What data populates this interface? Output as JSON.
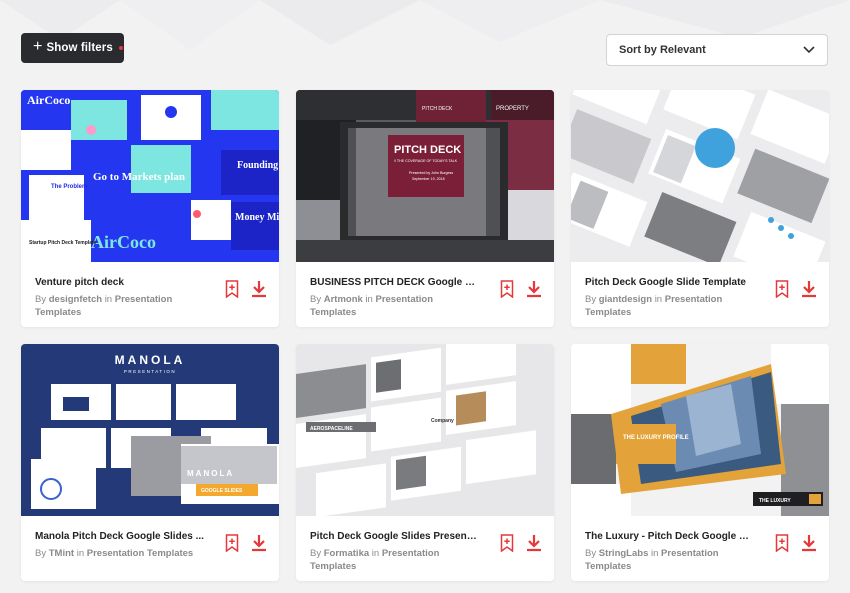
{
  "toolbar": {
    "filters_label": "Show filters",
    "sort_label": "Sort by Relevant"
  },
  "colors": {
    "accent": "#e5383b",
    "dark": "#2a2b2e"
  },
  "icons": {
    "bookmark": "bookmark-add-icon",
    "download": "download-icon",
    "sort": "chevron-down-icon"
  },
  "cards": [
    {
      "title": "Venture pitch deck",
      "by_prefix": "By",
      "author": "designfetch",
      "in_word": "in",
      "category": "Presentation Templates"
    },
    {
      "title": "BUSINESS PITCH DECK Google Sli...",
      "by_prefix": "By",
      "author": "Artmonk",
      "in_word": "in",
      "category": "Presentation Templates"
    },
    {
      "title": "Pitch Deck Google Slide Template",
      "by_prefix": "By",
      "author": "giantdesign",
      "in_word": "in",
      "category": "Presentation Templates"
    },
    {
      "title": "Manola Pitch Deck Google Slides ...",
      "by_prefix": "By",
      "author": "TMint",
      "in_word": "in",
      "category": "Presentation Templates"
    },
    {
      "title": "Pitch Deck Google Slides Presenta...",
      "by_prefix": "By",
      "author": "Formatika",
      "in_word": "in",
      "category": "Presentation Templates"
    },
    {
      "title": "The Luxury - Pitch Deck Google Sl...",
      "by_prefix": "By",
      "author": "StringLabs",
      "in_word": "in",
      "category": "Presentation Templates"
    }
  ],
  "thumb_text": {
    "c1": {
      "brand_top": "AirCoco",
      "slide_a": "Go to Markets plan",
      "slide_b": "Founding Team",
      "slide_c": "Money Miles",
      "brand_bottom": "AirCoco",
      "problem": "The Problem",
      "caption": "Startup Pitch Deck Template"
    },
    "c2": {
      "hero": "PITCH DECK",
      "sub": "// THE COVERAGE OF TODAY'S TALK",
      "presenter": "Presented by John Burgess",
      "date": "September 19, 2018",
      "tile_a": "PITCH DECK",
      "tile_b": "PROPERTY"
    },
    "c4": {
      "brand": "MANOLA",
      "sub": "PRESENTATION",
      "brand_small": "MANOLA",
      "badge": "GOOGLE SLIDES"
    },
    "c5": {
      "tile": "AEROSPACELINE",
      "word": "Company"
    },
    "c6": {
      "profile": "THE LUXURY PROFILE",
      "badge": "THE LUXURY"
    }
  }
}
